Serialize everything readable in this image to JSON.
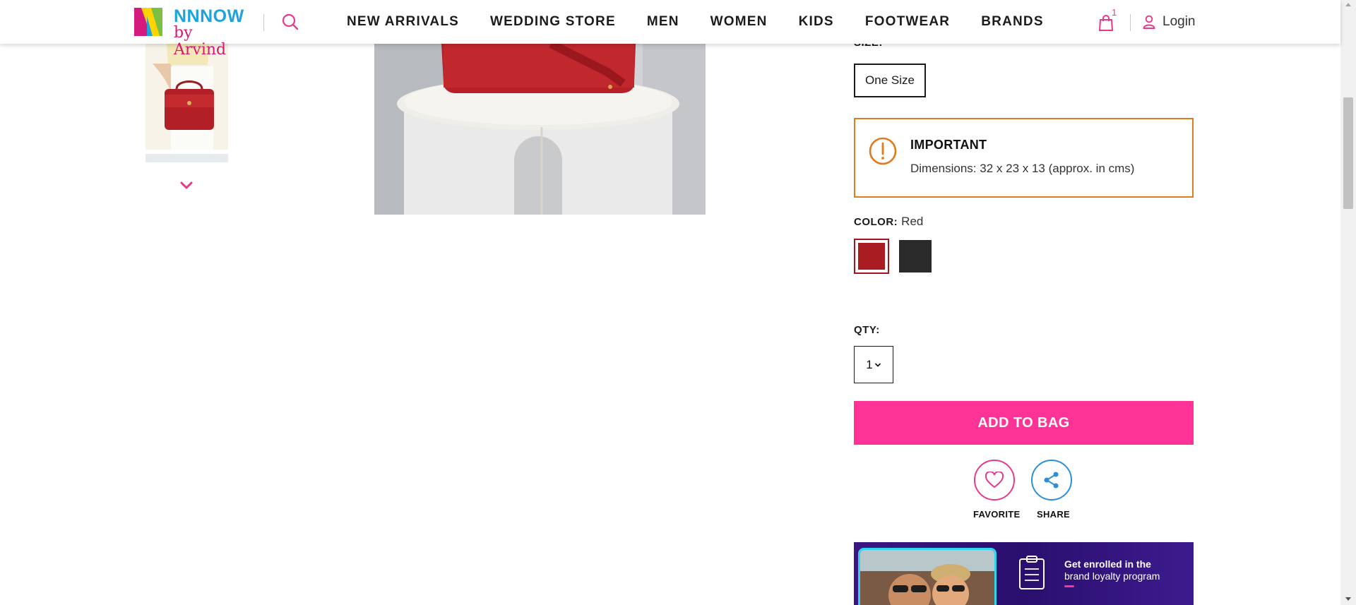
{
  "header": {
    "logo": {
      "brand": "NNNOW",
      "sub": "by Arvind"
    },
    "nav": [
      "NEW ARRIVALS",
      "WEDDING STORE",
      "MEN",
      "WOMEN",
      "KIDS",
      "FOOTWEAR",
      "BRANDS"
    ],
    "bag_count": "1",
    "login_label": "Login",
    "icons": {
      "search": "search-icon",
      "bag": "shopping-bag-icon",
      "user": "user-icon"
    }
  },
  "gallery": {
    "icons": {
      "next": "chevron-down-icon"
    }
  },
  "product": {
    "size": {
      "label": "SIZE:",
      "option": "One Size"
    },
    "important": {
      "title": "IMPORTANT",
      "text": "Dimensions: 32 x 23 x 13 (approx. in cms)",
      "icon": "alert-icon"
    },
    "color": {
      "label": "COLOR:",
      "value": "Red",
      "swatches": [
        {
          "name": "Red",
          "hex": "#a81c22",
          "selected": true
        },
        {
          "name": "Black",
          "hex": "#2a2a2a",
          "selected": false
        }
      ]
    },
    "qty": {
      "label": "QTY:",
      "value": "1"
    },
    "add_to_bag": "ADD TO BAG",
    "actions": {
      "favorite": "FAVORITE",
      "share": "SHARE"
    }
  },
  "promo": {
    "line1": "Get enrolled in the",
    "line2": "brand loyalty program"
  },
  "colors": {
    "accent_pink": "#ff3396",
    "logo_blue": "#1ea3dc",
    "important_border": "#e07a1c",
    "share_blue": "#2b90d9"
  }
}
